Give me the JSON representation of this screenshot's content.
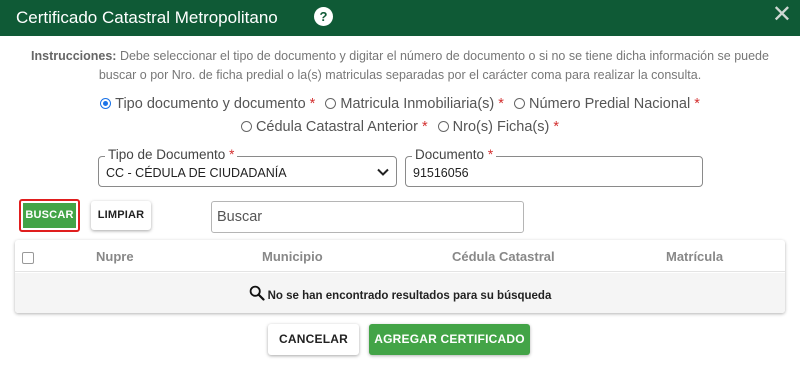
{
  "header": {
    "title": "Certificado Catastral Metropolitano",
    "help_icon": "?",
    "close_icon": "✕"
  },
  "instructions": {
    "label": "Instrucciones:",
    "text": "Debe seleccionar el tipo de documento y digitar el número de documento o si no se tiene dicha información se puede buscar o por Nro. de ficha predial o la(s) matriculas separadas por el carácter coma para realizar la consulta."
  },
  "search_options": {
    "selected": "Tipo documento y documento",
    "options": [
      {
        "label": "Tipo documento y documento",
        "required": "*"
      },
      {
        "label": "Matricula Inmobiliaria(s)",
        "required": "*"
      },
      {
        "label": "Número Predial Nacional",
        "required": "*"
      },
      {
        "label": "Cédula Catastral Anterior",
        "required": "*"
      },
      {
        "label": "Nro(s) Ficha(s)",
        "required": "*"
      }
    ]
  },
  "form": {
    "tipo_documento": {
      "label": "Tipo de Documento",
      "required": "*",
      "value": "CC - CÉDULA DE CIUDADANÍA"
    },
    "documento": {
      "label": "Documento",
      "required": "*",
      "value": "91516056"
    }
  },
  "actions": {
    "buscar": "BUSCAR",
    "limpiar": "LIMPIAR",
    "search_placeholder": "Buscar"
  },
  "table": {
    "columns": [
      "Nupre",
      "Municipio",
      "Cédula Catastral",
      "Matrícula"
    ],
    "empty_message": "No se han encontrado resultados para su búsqueda"
  },
  "footer": {
    "cancelar": "CANCELAR",
    "agregar": "AGREGAR CERTIFICADO"
  },
  "colors": {
    "header_bg": "#0f5a36",
    "primary_green": "#43a447",
    "highlight_red": "#e01e1e",
    "radio_blue": "#1a73e8"
  }
}
